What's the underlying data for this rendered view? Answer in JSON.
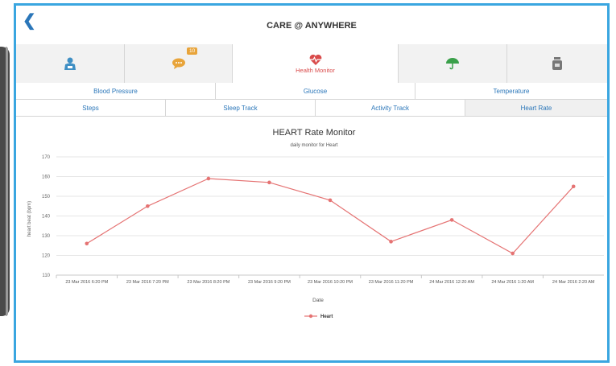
{
  "app": {
    "title": "CARE @ ANYWHERE",
    "back_icon": "chevron-left-icon"
  },
  "icon_tabs": [
    {
      "name": "doctor",
      "icon": "doctor-icon",
      "label": "",
      "badge": ""
    },
    {
      "name": "messages",
      "icon": "chat-icon",
      "label": "",
      "badge": "10"
    },
    {
      "name": "health-monitor",
      "icon": "heart-monitor-icon",
      "label": "Health Monitor",
      "badge": "",
      "active": true
    },
    {
      "name": "insurance",
      "icon": "umbrella-icon",
      "label": "",
      "badge": ""
    },
    {
      "name": "medicine",
      "icon": "medicine-bottle-icon",
      "label": "",
      "badge": ""
    }
  ],
  "sub_tabs_row1": [
    "Blood Pressure",
    "Glucose",
    "Temperature"
  ],
  "sub_tabs_row2": [
    "Steps",
    "Sleep Track",
    "Activity Track",
    "Heart Rate"
  ],
  "active_sub_tab": "Heart Rate",
  "colors": {
    "accent": "#3aa6e0",
    "link": "#2a76b9",
    "series": "#e57373",
    "badge": "#e8a43a"
  },
  "chart_data": {
    "type": "line",
    "title": "HEART Rate Monitor",
    "subtitle": "daily monitor for Heart",
    "xlabel": "Date",
    "ylabel": "heart beat (bpm)",
    "categories": [
      "23 Mar 2016 6:20 PM",
      "23 Mar 2016 7:20 PM",
      "23 Mar 2016 8:20 PM",
      "23 Mar 2016 9:20 PM",
      "23 Mar 2016 10:20 PM",
      "23 Mar 2016 11:20 PM",
      "24 Mar 2016 12:20 AM",
      "24 Mar 2016 1:20 AM",
      "24 Mar 2016 2:20 AM"
    ],
    "series": [
      {
        "name": "Heart",
        "values": [
          126,
          145,
          159,
          157,
          148,
          127,
          138,
          121,
          155
        ]
      }
    ],
    "ylim": [
      110,
      170
    ],
    "yticks": [
      110,
      120,
      130,
      140,
      150,
      160,
      170
    ],
    "grid": true,
    "legend": "bottom-center"
  }
}
